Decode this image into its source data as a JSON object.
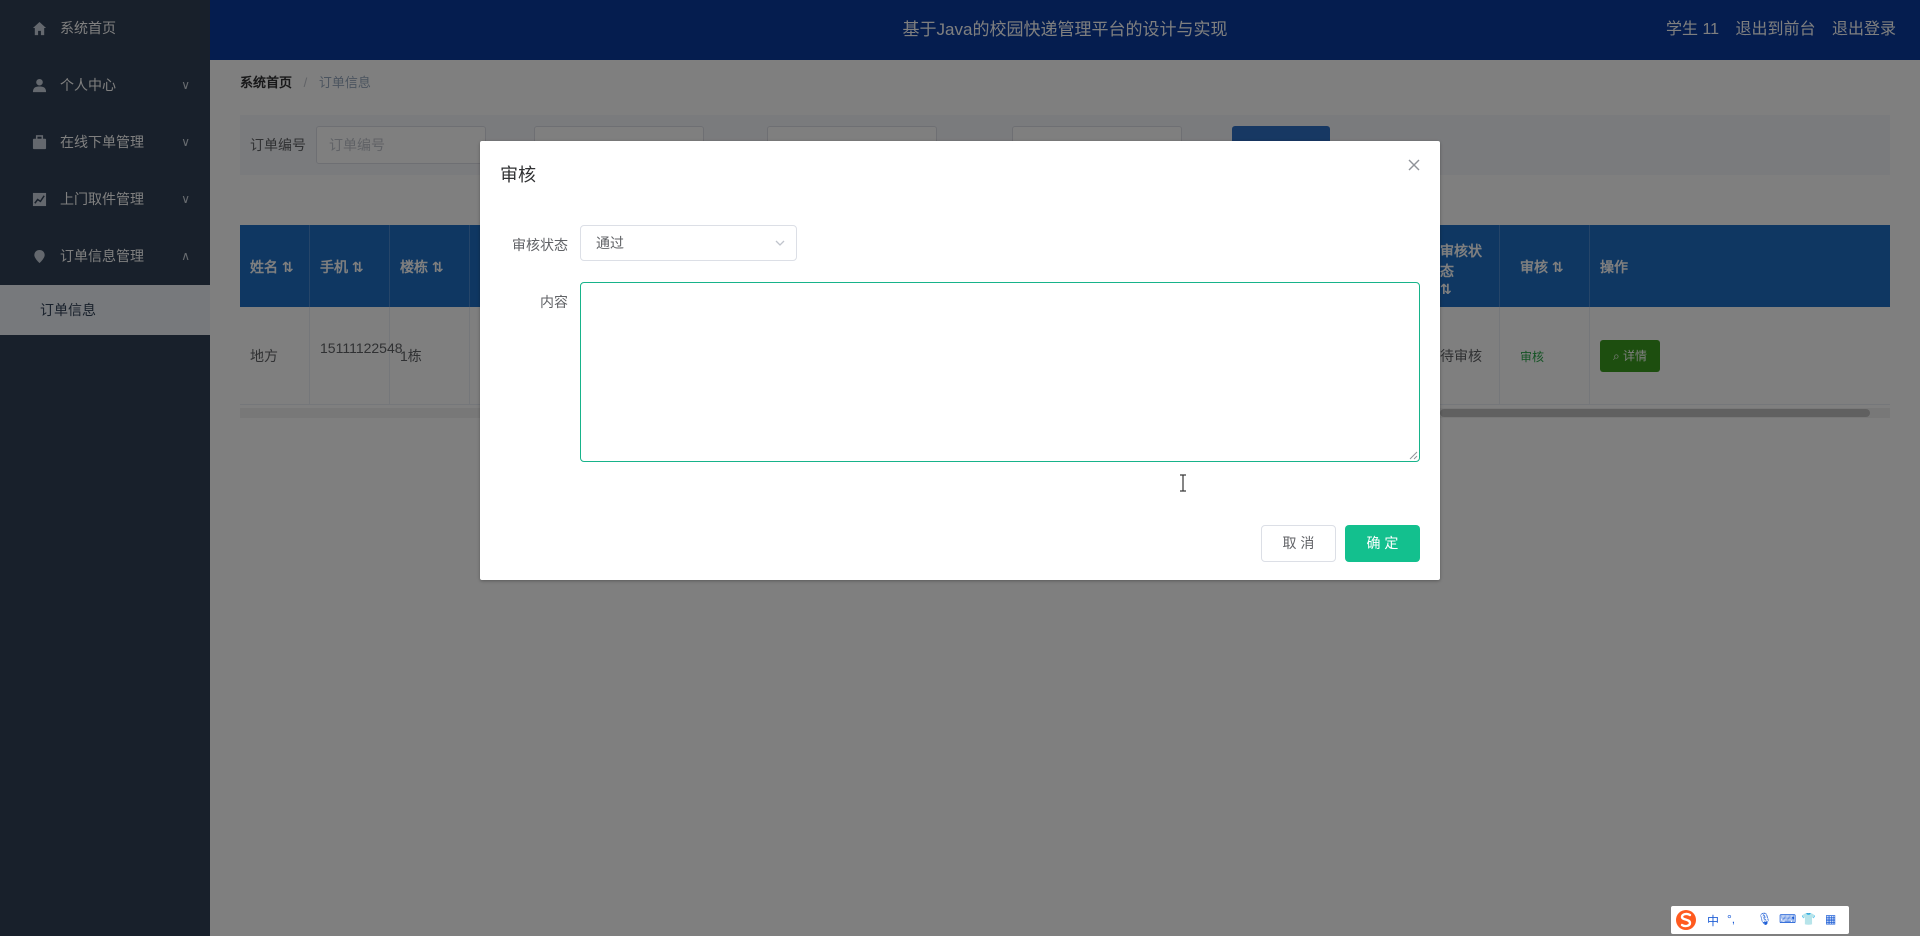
{
  "sidebar": {
    "items": [
      {
        "label": "系统首页",
        "icon": "home-icon",
        "has_arrow": false
      },
      {
        "label": "个人中心",
        "icon": "user-icon",
        "arrow": "∨"
      },
      {
        "label": "在线下单管理",
        "icon": "briefcase-icon",
        "arrow": "∨"
      },
      {
        "label": "上门取件管理",
        "icon": "chart-icon",
        "arrow": "∨"
      },
      {
        "label": "订单信息管理",
        "icon": "location-icon",
        "arrow": "∧"
      }
    ],
    "submenu": {
      "label": "订单信息"
    }
  },
  "header": {
    "title": "基于Java的校园快递管理平台的设计与实现",
    "user": "学生 11",
    "back_to_front": "退出到前台",
    "logout": "退出登录"
  },
  "breadcrumb": {
    "home": "系统首页",
    "current": "订单信息"
  },
  "search": {
    "label1": "订单编号",
    "placeholder1": "订单编号"
  },
  "table": {
    "headers": [
      "姓名",
      "手机",
      "楼栋",
      "审核状态",
      "审核",
      "操作"
    ],
    "row": {
      "name": "地方",
      "phone": "15111122548",
      "building": "1栋",
      "status": "待审核",
      "audit": "审核",
      "detail": "详情"
    }
  },
  "dialog": {
    "title": "审核",
    "status_label": "审核状态",
    "status_value": "通过",
    "content_label": "内容",
    "content_value": "",
    "cancel": "取 消",
    "ok": "确 定"
  },
  "ime": {
    "label": "中"
  },
  "colors": {
    "sidebar_bg": "#304156",
    "header_bg": "#0a3b9e",
    "table_header_bg": "#1f6fc4",
    "ok_button": "#13c08e",
    "textarea_focus": "#17b38a"
  }
}
